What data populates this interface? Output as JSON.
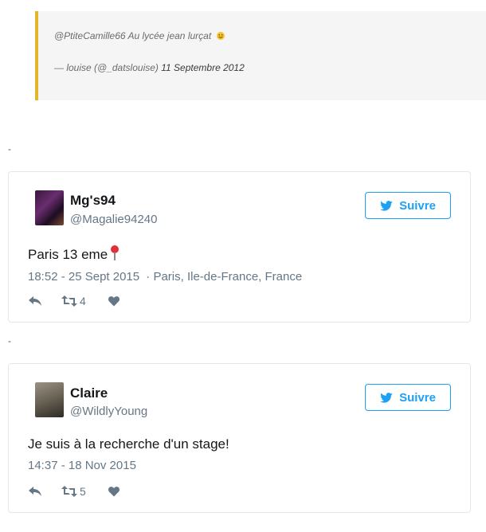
{
  "quote": {
    "text": "@PtiteCamille66 Au lycée jean lurçat",
    "attribution": "— louise (@_datslouise)",
    "date": "11 Septembre 2012"
  },
  "separators": [
    "-",
    "-"
  ],
  "tweets": [
    {
      "name": "Mg's94",
      "handle": "@Magalie94240",
      "follow_label": "Suivre",
      "text": "Paris 13 eme",
      "meta": "18:52 - 25 Sept 2015",
      "location": "· Paris, Ile-de-France, France",
      "retweets": "4"
    },
    {
      "name": "Claire",
      "handle": "@WildlyYoung",
      "follow_label": "Suivre",
      "text": "Je suis à la recherche d'un stage!",
      "meta": "14:37 - 18 Nov 2015",
      "retweets": "5"
    }
  ],
  "colors": {
    "twitter_blue": "#1da1f2",
    "muted": "#657786",
    "quote_border": "#e3b52c"
  },
  "icons": {
    "follow": "twitter-bird-icon",
    "reply": "reply-icon",
    "retweet": "retweet-icon",
    "like": "heart-icon"
  }
}
